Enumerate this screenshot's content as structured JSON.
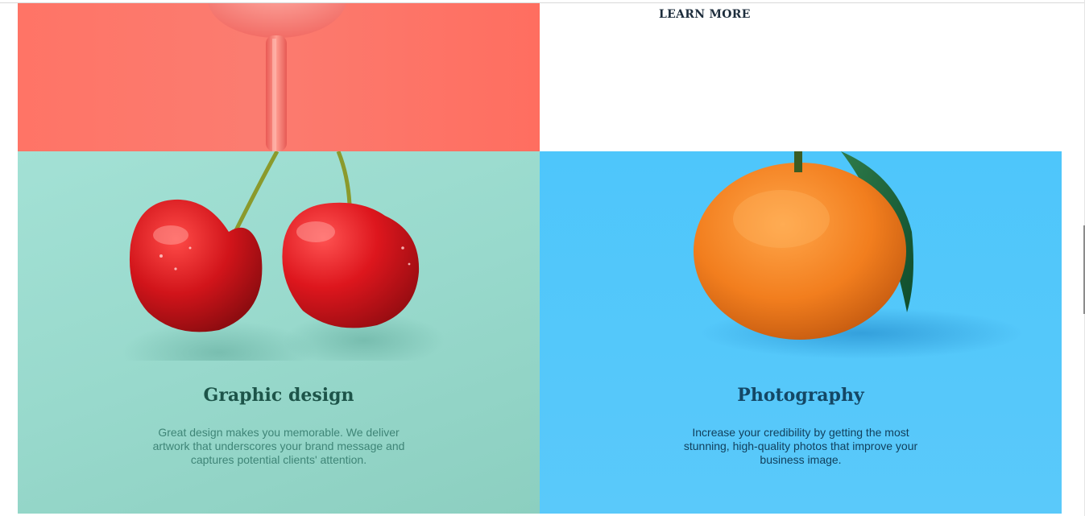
{
  "top_right_tile": {
    "link_label": "LEARN MORE"
  },
  "services": [
    {
      "title": "Graphic design",
      "description": "Great design makes you memorable. We deliver artwork that underscores your brand message and captures potential clients' attention.",
      "image": "cherries-on-mint"
    },
    {
      "title": "Photography",
      "description": "Increase your credibility by getting the most stunning, high-quality photos that improve your business image.",
      "image": "orange-on-blue"
    }
  ],
  "colors": {
    "coral": "#ff7466",
    "mint": "#98d9cc",
    "sky_blue": "#55c8fa",
    "heading_dark": "#1d2d3c"
  }
}
